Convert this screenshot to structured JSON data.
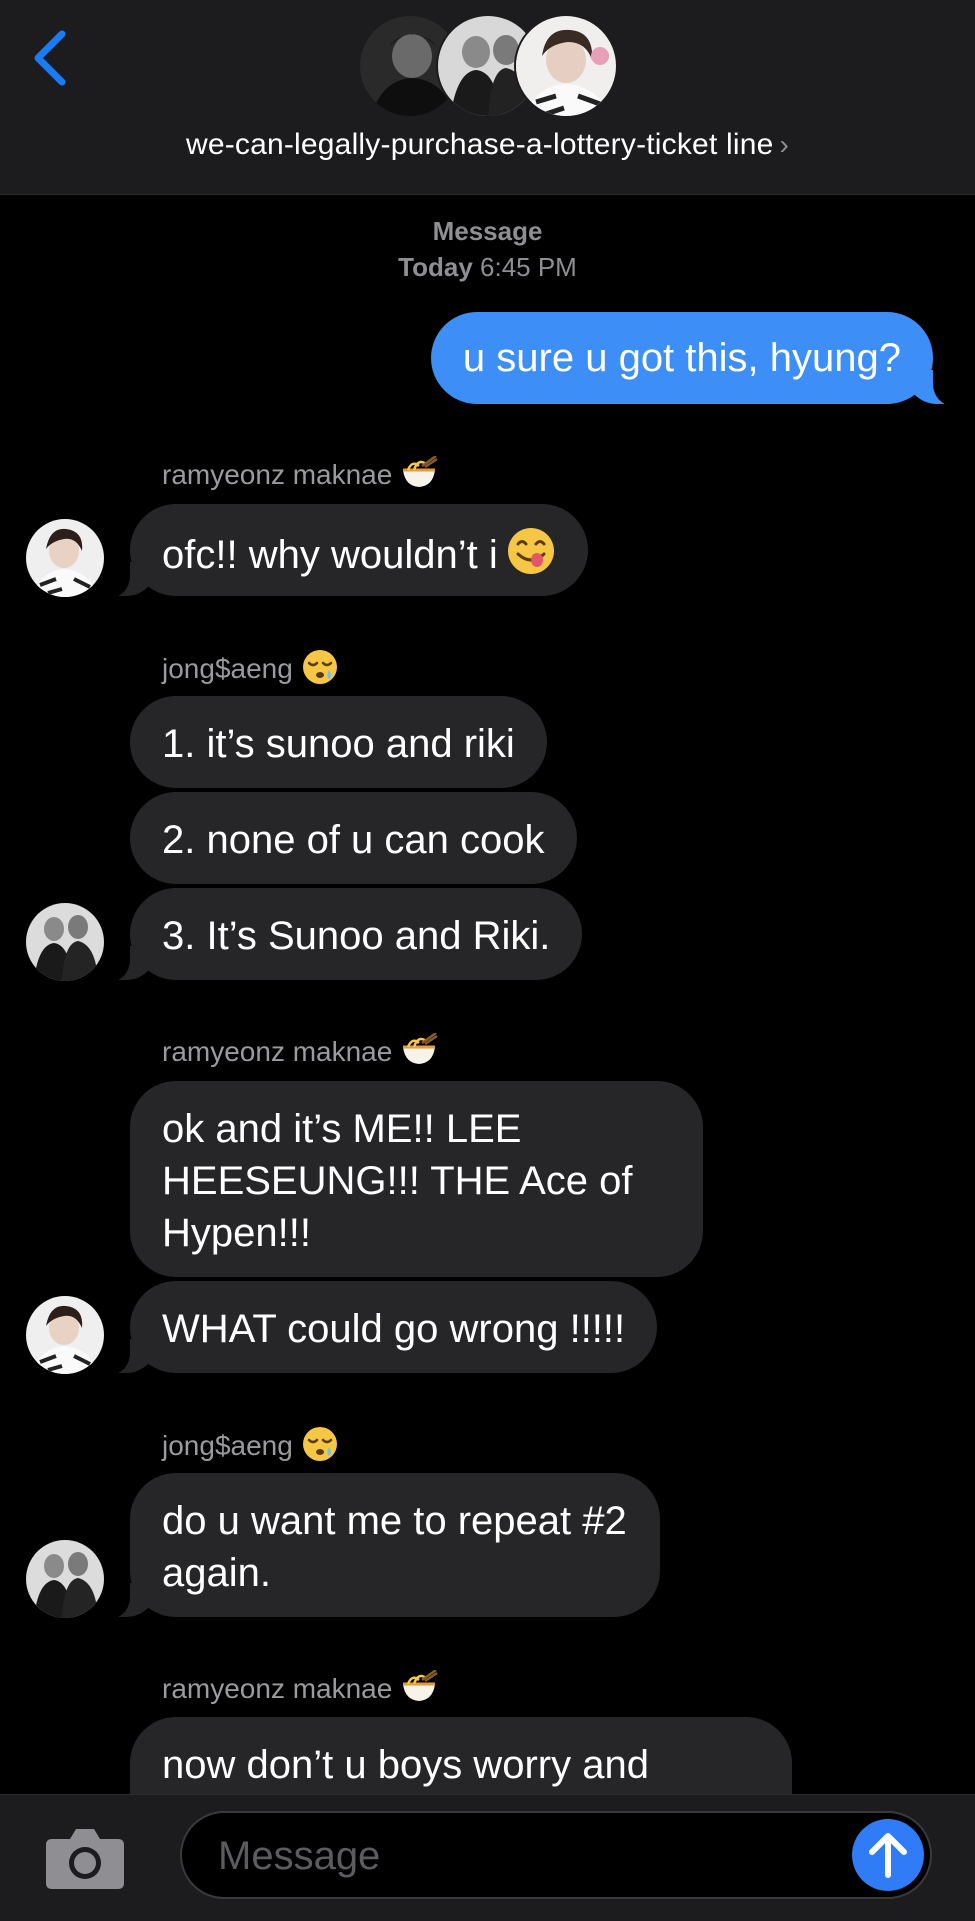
{
  "header": {
    "back_icon": "chevron-left-icon",
    "group_name": "we-can-legally-purchase-a-lottery-ticket line",
    "chevron": "›",
    "accent_color": "#1a7cf5"
  },
  "timestamp": {
    "service": "Message",
    "day": "Today",
    "time": "6:45 PM"
  },
  "messages": {
    "outgoing_1": "u sure u got this, hyung?",
    "sender_a": "ramyeonz maknae",
    "sender_b": "jong$aeng",
    "m1": "ofc!! why wouldn’t i",
    "m2": "1. it’s sunoo and riki",
    "m3": "2. none of u can cook",
    "m4": "3. It’s Sunoo and Riki.",
    "m5": "ok and it’s ME!! LEE HEESEUNG!!! THE Ace of Hypen!!!",
    "m6": "WHAT could go wrong !!!!!",
    "m7": "do u want me to repeat #2 again.",
    "m8": "now don’t u boys worry and"
  },
  "composer": {
    "placeholder": "Message",
    "camera_icon": "camera-icon",
    "send_icon": "arrow-up-icon"
  },
  "colors": {
    "outgoing_bubble": "#3e8ef7",
    "incoming_bubble": "#262628",
    "background": "#000000"
  }
}
